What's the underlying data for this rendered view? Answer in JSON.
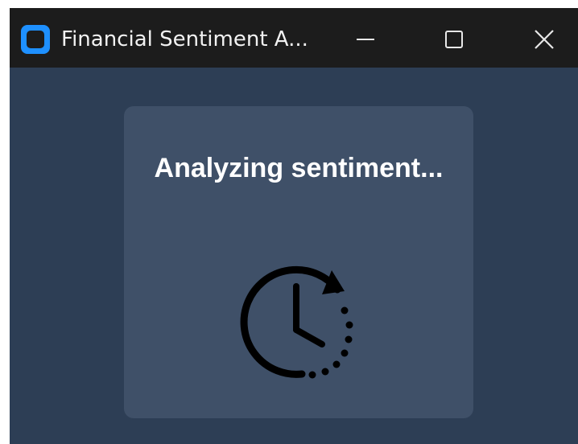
{
  "window": {
    "title": "Financial Sentiment A...",
    "icon": "app-icon",
    "controls": {
      "minimize_icon": "minimize-icon",
      "maximize_icon": "maximize-icon",
      "close_icon": "close-icon"
    }
  },
  "loading_card": {
    "message": "Analyzing sentiment...",
    "icon": "clock-refresh-icon"
  },
  "colors": {
    "titlebar": "#1c1c1c",
    "window_background": "#2d3e55",
    "card_background": "#3f5068",
    "app_icon_accent": "#1e90ff",
    "text": "#ffffff"
  }
}
